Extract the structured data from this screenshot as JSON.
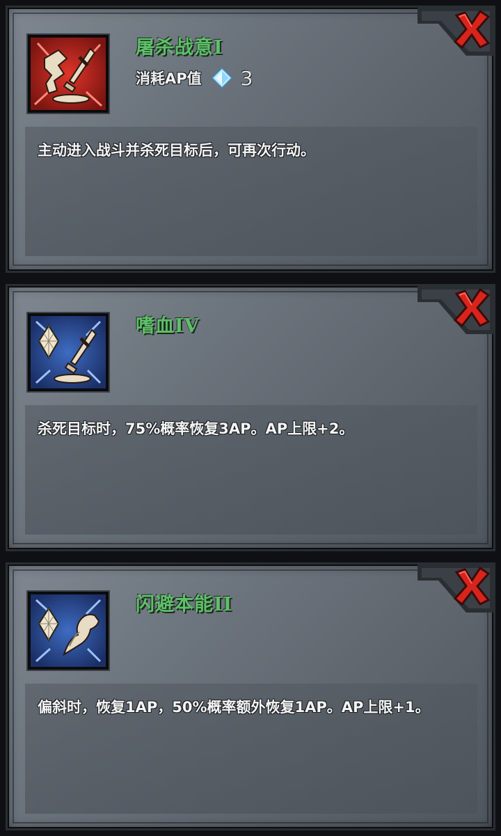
{
  "colors": {
    "skill_name": "#5fbf6a",
    "close_x": "#d9241c",
    "icon_red_bg": "#b8231c",
    "icon_blue_bg": "#2b4f9c"
  },
  "skills": [
    {
      "name": "屠杀战意I",
      "icon": "slash-broken-sword-icon",
      "ap_cost_label": "消耗AP值",
      "ap_cost_icon": "diamond-gem-icon",
      "ap_cost_value": "3",
      "description": "主动进入战斗并杀死目标后，可再次行动。"
    },
    {
      "name": "嗜血IV",
      "icon": "crystal-sword-icon",
      "description": "杀死目标时，75%概率恢复3AP。AP上限+2。"
    },
    {
      "name": "闪避本能II",
      "icon": "crystal-dodge-icon",
      "description": "偏斜时，恢复1AP，50%概率额外恢复1AP。AP上限+1。"
    }
  ],
  "close_icon": "close-x-icon"
}
